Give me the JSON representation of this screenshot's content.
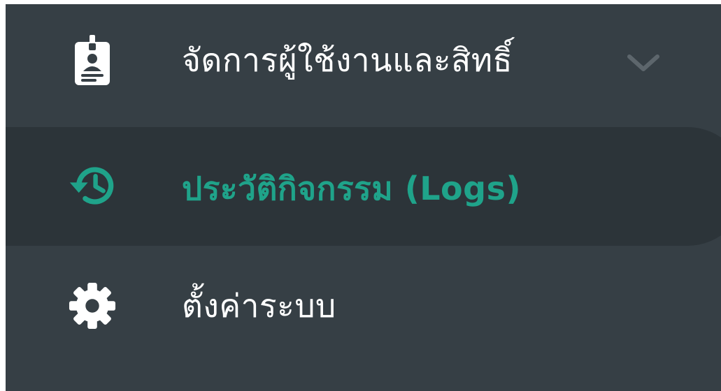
{
  "menu": {
    "items": [
      {
        "label": "จัดการผู้ใช้งานและสิทธิ์",
        "icon": "id-badge-icon",
        "expandable": true,
        "expand_icon": "chevron-down-icon"
      },
      {
        "label": "ประวัติกิจกรรม (Logs)",
        "icon": "history-icon",
        "active": true
      },
      {
        "label": "ตั้งค่าระบบ",
        "icon": "gear-icon"
      }
    ]
  },
  "colors": {
    "sidebar_bg": "#363f45",
    "active_bg": "#2c3439",
    "active_text": "#1fa38a",
    "text": "#ffffff",
    "chevron": "#5d666c"
  }
}
